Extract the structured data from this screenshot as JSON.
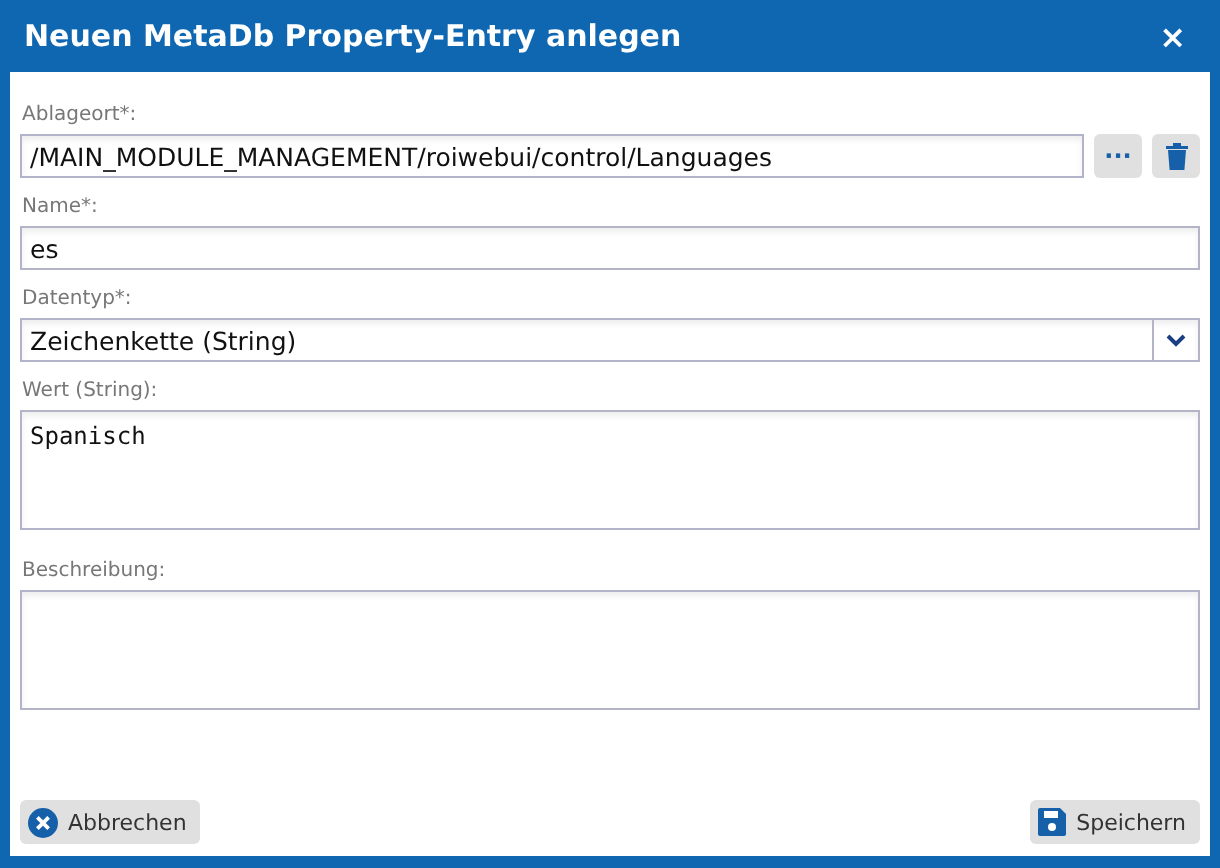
{
  "window": {
    "title": "Neuen MetaDb Property-Entry anlegen",
    "close": "×"
  },
  "fields": [
    {
      "kind": "path",
      "label": "Ablageort*:",
      "value": "/MAIN_MODULE_MANAGEMENT/roiwebui/control/Languages",
      "browse": "···"
    },
    {
      "kind": "text",
      "label": "Name*:",
      "value": "es"
    },
    {
      "kind": "select",
      "label": "Datentyp*:",
      "value": "Zeichenkette (String)"
    },
    {
      "kind": "area",
      "label": "Wert (String):",
      "value": "Spanisch"
    },
    {
      "kind": "area",
      "label": "Beschreibung:"
    }
  ],
  "buttons": [
    {
      "kind": "cancel",
      "label": "Abbrechen"
    },
    {
      "kind": "save",
      "label": "Speichern"
    }
  ]
}
